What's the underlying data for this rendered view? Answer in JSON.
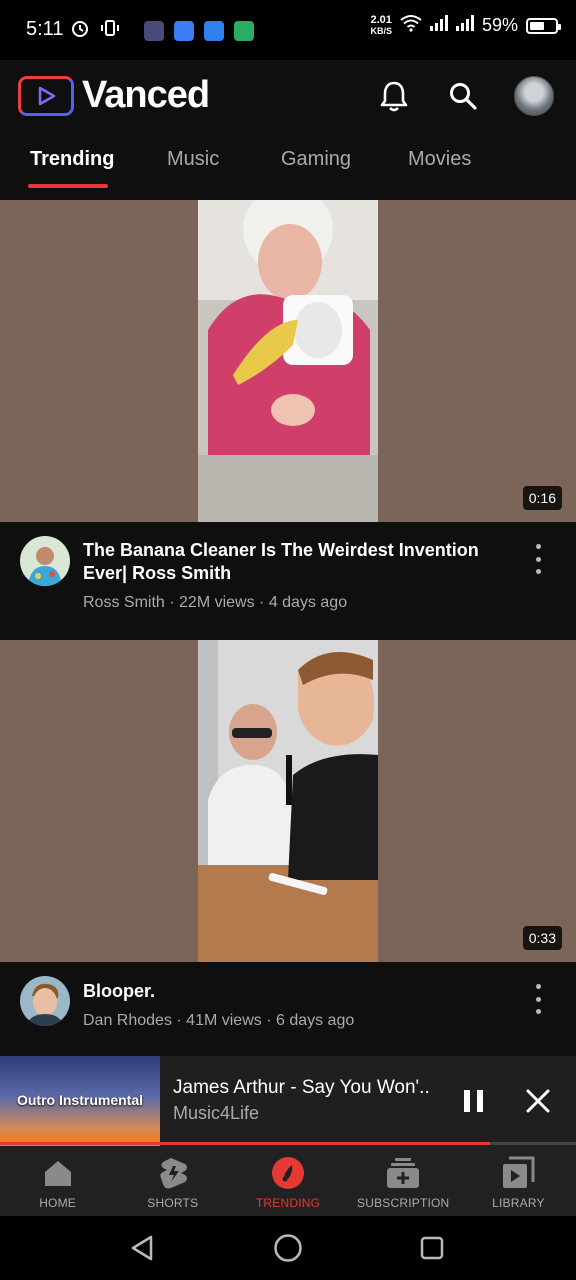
{
  "status_bar": {
    "time": "5:11",
    "net_speed_value": "2.01",
    "net_speed_unit": "KB/S",
    "battery": "59%",
    "battery_level": 0.59
  },
  "header": {
    "app_name": "Vanced",
    "icons": [
      "bell-icon",
      "search-icon",
      "avatar"
    ]
  },
  "tabs": [
    {
      "label": "Trending",
      "active": true
    },
    {
      "label": "Music",
      "active": false
    },
    {
      "label": "Gaming",
      "active": false
    },
    {
      "label": "Movies",
      "active": false
    }
  ],
  "videos": [
    {
      "title": "The Banana Cleaner Is The Weirdest Invention Ever| Ross Smith",
      "channel": "Ross Smith",
      "views": "22M views",
      "age": "4 days ago",
      "duration": "0:16"
    },
    {
      "title": "Blooper.",
      "channel": "Dan Rhodes",
      "views": "41M views",
      "age": "6 days ago",
      "duration": "0:33"
    }
  ],
  "mini_player": {
    "art_text": "Outro Instrumental",
    "title": "James Arthur - Say You Won'..",
    "channel": "Music4Life",
    "progress": 0.85
  },
  "bottom_nav": [
    {
      "label": "HOME",
      "icon": "home-icon",
      "active": false
    },
    {
      "label": "SHORTS",
      "icon": "shorts-icon",
      "active": false
    },
    {
      "label": "TRENDING",
      "icon": "trending-icon",
      "active": true
    },
    {
      "label": "SUBSCRIPTION",
      "icon": "subscription-icon",
      "active": false
    },
    {
      "label": "LIBRARY",
      "icon": "library-icon",
      "active": false
    }
  ],
  "colors": {
    "accent": "#e53935",
    "background": "#0f0f0f",
    "secondary_text": "#aaaaaa"
  }
}
